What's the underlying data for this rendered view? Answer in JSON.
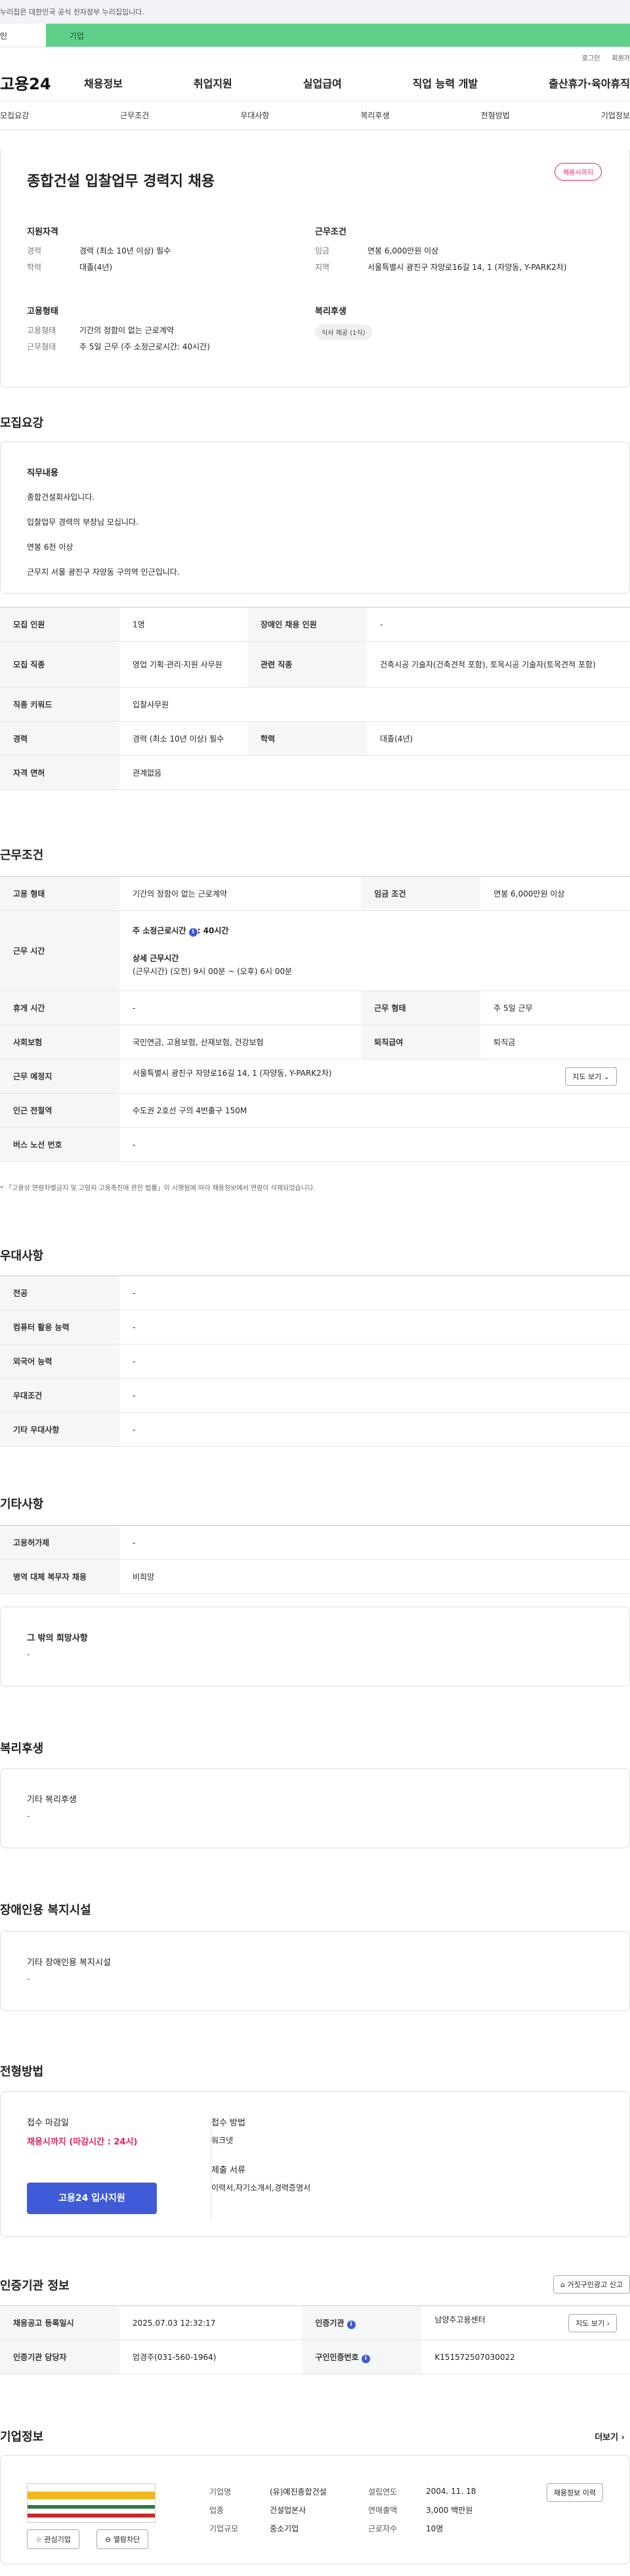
{
  "notice": {
    "text": "누리집은 대한민국 공식 전자정부 누리집입니다."
  },
  "usertabs": {
    "personal": "인",
    "corp": "기업"
  },
  "util": {
    "login": "로그인",
    "join": "회원가"
  },
  "gnb": {
    "logo": "고용24",
    "menu": [
      "채용정보",
      "취업지원",
      "실업급여",
      "직업 능력 개발",
      "출산휴가·육아휴직"
    ]
  },
  "subnav": [
    "모집요강",
    "근무조건",
    "우대사항",
    "복리후생",
    "전형방법",
    "기업정보"
  ],
  "header": {
    "title": "종합건설 입찰업무 경력지 채용",
    "badge": "채용시까지",
    "qual": {
      "title": "지원자격",
      "rows": [
        {
          "k": "경력",
          "v": "경력 (최소 10년 이상) 필수"
        },
        {
          "k": "학력",
          "v": "대졸(4년)"
        }
      ]
    },
    "cond": {
      "title": "근무조건",
      "rows": [
        {
          "k": "임금",
          "v": "연봉 6,000만원 이상"
        },
        {
          "k": "지역",
          "v": "서울특별시 광진구 자양로16길 14, 1 (자양동, Y-PARK2차)"
        }
      ]
    },
    "emp": {
      "title": "고용형태",
      "rows": [
        {
          "k": "고용형태",
          "v": "기간의 정함이 없는 근로계약"
        },
        {
          "k": "근무형태",
          "v": "주 5일 근무 (주 소정근로시간: 40시간)"
        }
      ]
    },
    "welfare": {
      "title": "복리후생",
      "chip": "식사 제공 (1식)"
    }
  },
  "recruit": {
    "title": "모집요강",
    "duty_title": "직무내용",
    "duty_lines": [
      "종합건설회사입니다.",
      "입찰업무 경력의 부장님 모십니다.",
      "연봉 6천 이상",
      "근무지 서울 광진구 자양동 구의역 인근입니다."
    ],
    "table": [
      {
        "k1": "모집 인원",
        "v1": "1명",
        "k2": "장애인 채용 인원",
        "v2": "-"
      },
      {
        "k1": "모집 직종",
        "v1": "영업 기획·관리·지원 사무원",
        "k2": "관련 직종",
        "v2": "건축시공 기술자(건축견적 포함), 토목시공 기술자(토목견적 포함)"
      },
      {
        "k1": "직종 키워드",
        "v1": "입찰사무원"
      },
      {
        "k1": "경력",
        "v1": "경력 (최소 10년 이상) 필수",
        "k2": "학력",
        "v2": "대졸(4년)"
      },
      {
        "k1": "자격 면허",
        "v1": "관계없음"
      }
    ]
  },
  "work": {
    "title": "근무조건",
    "type_k": "고용 형태",
    "type_v": "기간의 정함이 없는 근로계약",
    "wage_k": "임금 조건",
    "wage_v": "연봉 6,000만원 이상",
    "hours_k": "근무 시간",
    "hours_week": "주 소정근로시간",
    "hours_week_v": ": 40시간",
    "hours_detail_t": "상세 근무시간",
    "hours_detail_v": "(근무시간) (오전) 9시 00분 ~ (오후) 6시 00분",
    "holiday_k": "휴게 시간",
    "holiday_v": "-",
    "form_k": "근무 형태",
    "form_v": "주 5일 근무",
    "ins_k": "사회보험",
    "ins_v": "국민연금, 고용보험, 산재보험, 건강보험",
    "sev_k": "퇴직급여",
    "sev_v": "퇴직금",
    "place_k": "근무 예정지",
    "place_v": "서울특별시 광진구 자양로16길 14, 1 (자양동, Y-PARK2차)",
    "map_btn": "지도 보기",
    "station_k": "인근 전철역",
    "station_v": "수도권 2호선 구의 4번출구 150M",
    "bus_k": "버스 노선 번호",
    "bus_v": "-",
    "note": "* 「고용상 연령차별금지 및 고령자 고용촉진에 관한 법률」이 시행됨에 따라 채용정보에서 연령이 삭제되었습니다."
  },
  "pref": {
    "title": "우대사항",
    "rows": [
      {
        "k": "전공",
        "v": "-"
      },
      {
        "k": "컴퓨터 활용 능력",
        "v": "-"
      },
      {
        "k": "외국어 능력",
        "v": "-"
      },
      {
        "k": "우대조건",
        "v": "-"
      },
      {
        "k": "기타 우대사항",
        "v": "-"
      }
    ]
  },
  "other": {
    "title": "기타사항",
    "rows": [
      {
        "k": "고용허가제",
        "v": "-"
      },
      {
        "k": "병역 대체 복무자 채용",
        "v": "비희망"
      }
    ],
    "wish_title": "그 밖의 희망사항",
    "wish_v": "-"
  },
  "benefit": {
    "title": "복리후생",
    "sub": "기타 복리후생",
    "v": "-"
  },
  "disab": {
    "title": "장애인용 복지시설",
    "sub": "기타 장애인용 복지시설",
    "v": "-"
  },
  "selection": {
    "title": "전형방법",
    "deadline_t": "접수 마감일",
    "deadline_v": "채용시까지 (마감시간 : 24시)",
    "apply_btn": "고용24 입사지원",
    "method_t": "접수 방법",
    "method_v": "워크넷",
    "docs_t": "제출 서류",
    "docs_v": "이력서,자기소개서,경력증명서"
  },
  "cert": {
    "title": "인증기관 정보",
    "report_btn": "거짓구인광고 신고",
    "rows": [
      {
        "k1": "채용공고 등록일시",
        "v1": "2025.07.03 12:32:17",
        "k2": "인증기관",
        "v2": "남양주고용센터",
        "btn": "지도 보기"
      },
      {
        "k1": "인증기관 담당자",
        "v1": "엄경주(031-560-1964)",
        "k2": "구인인증번호",
        "v2": "K151572507030022"
      }
    ]
  },
  "company": {
    "title": "기업정보",
    "more": "더보기",
    "fav": "관심기업",
    "block": "열람차단",
    "history_btn": "채용정보 이력",
    "rows": [
      {
        "k1": "기업명",
        "v1": "(유)예진종합건설",
        "k2": "설립연도",
        "v2": "2004. 11. 18"
      },
      {
        "k1": "업종",
        "v1": "건설업본사",
        "k2": "연매출액",
        "v2": "3,000 백만원"
      },
      {
        "k1": "기업규모",
        "v1": "중소기업",
        "k2": "근로자수",
        "v2": "10명"
      }
    ]
  }
}
